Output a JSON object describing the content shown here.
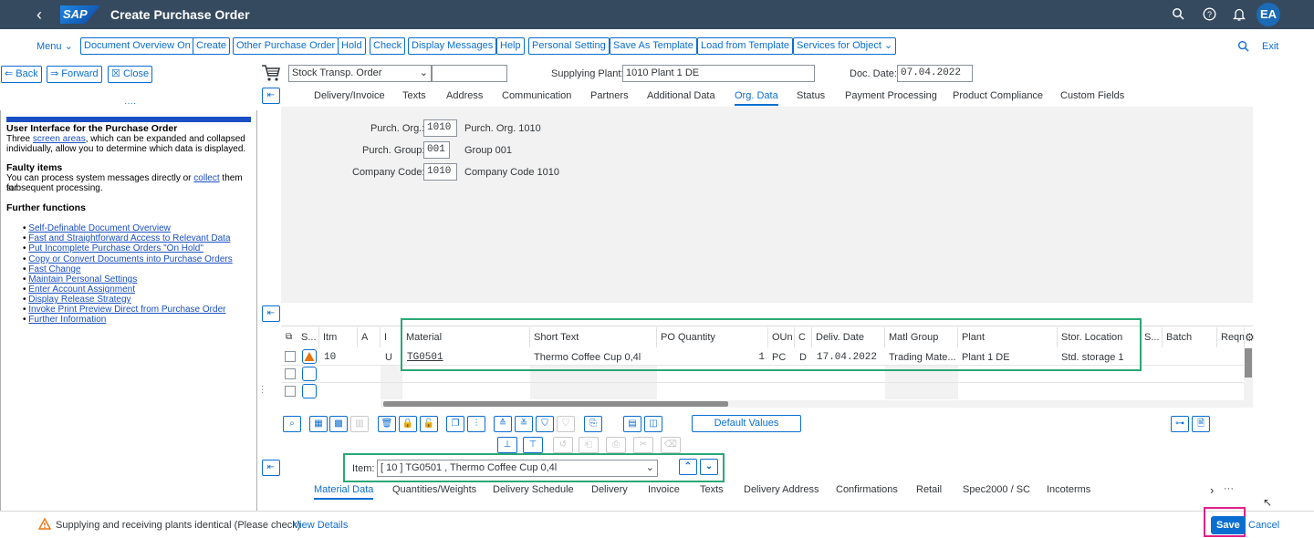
{
  "shell": {
    "title": "Create Purchase Order",
    "logo": "SAP",
    "avatar": "EA",
    "icons": [
      "back-icon",
      "search-icon",
      "help-icon",
      "bell-icon"
    ]
  },
  "toolbar": {
    "menu": "Menu",
    "buttons": [
      "Document Overview On",
      "Create",
      "Other Purchase Order",
      "Hold",
      "Check",
      "Display Messages",
      "Help",
      "Personal Setting",
      "Save As Template",
      "Load from Template",
      "Services for Object"
    ],
    "exit": "Exit"
  },
  "nav": {
    "back": "Back",
    "forward": "Forward",
    "close": "Close"
  },
  "left_pane": {
    "title": "User Interface for the Purchase Order",
    "l1a": "Three ",
    "l1link": "screen areas",
    "l1b": ", which can be expanded and collapsed",
    "l2": "individually, allow you to determine which data is displayed.",
    "faulty_title": "Faulty items",
    "f1a": "You can process system messages directly or ",
    "f1link": "collect",
    "f1b": " them for",
    "f2": "subsequent processing.",
    "further_title": "Further functions",
    "links": [
      "Self-Definable Document Overview",
      "Fast and Straightforward Access to Relevant Data",
      "Put Incomplete Purchase Orders \"On Hold\"",
      "Copy or Convert Documents into Purchase Orders",
      "Fast Change",
      "Maintain Personal Settings",
      "Enter Account Assignment",
      "Display Release Strategy",
      "Invoke Print Preview Direct from Purchase Order",
      "Further Information"
    ]
  },
  "header": {
    "order_type": "Stock Transp. Order",
    "doc_number": "",
    "supplying_plant_label": "Supplying Plant:",
    "supplying_plant_value": "1010 Plant 1 DE",
    "doc_date_label": "Doc. Date:",
    "doc_date_value": "07.04.2022",
    "tabs": [
      "Delivery/Invoice",
      "Texts",
      "Address",
      "Communication",
      "Partners",
      "Additional Data",
      "Org. Data",
      "Status",
      "Payment Processing",
      "Product Compliance",
      "Custom Fields"
    ],
    "active_tab": "Org. Data"
  },
  "org": {
    "purch_org_label": "Purch. Org.:",
    "purch_org_value": "1010",
    "purch_org_desc": "Purch. Org. 1010",
    "purch_group_label": "Purch. Group:",
    "purch_group_value": "001",
    "purch_group_desc": "Group 001",
    "company_code_label": "Company Code:",
    "company_code_value": "1010",
    "company_code_desc": "Company Code 1010"
  },
  "items": {
    "columns": [
      "S...",
      "Itm",
      "A",
      "I",
      "Material",
      "Short Text",
      "PO Quantity",
      "OUn",
      "C",
      "Deliv. Date",
      "Matl Group",
      "Plant",
      "Stor. Location",
      "S...",
      "Batch",
      "Reqm"
    ],
    "row": {
      "itm": "10",
      "i": "U",
      "material": "TG0501",
      "short_text": "Thermo Coffee Cup 0,4l",
      "po_quantity": "1",
      "oun": "PC",
      "c": "D",
      "deliv_date": "17.04.2022",
      "matl_group": "Trading Mate...",
      "plant": "Plant 1 DE",
      "stor_location": "Std. storage 1"
    },
    "default_values": "Default Values"
  },
  "item_detail": {
    "label": "Item:",
    "value": "[ 10 ] TG0501 , Thermo Coffee Cup 0,4l",
    "tabs": [
      "Material Data",
      "Quantities/Weights",
      "Delivery Schedule",
      "Delivery",
      "Invoice",
      "Texts",
      "Delivery Address",
      "Confirmations",
      "Retail",
      "Spec2000 / SC",
      "Incoterms"
    ],
    "active_tab": "Material Data"
  },
  "footer": {
    "message": "Supplying and receiving plants identical (Please check)",
    "view_details": "View Details",
    "save": "Save",
    "cancel": "Cancel"
  },
  "colors": {
    "shell": "#354a5f",
    "accent": "#0a6ed1",
    "highlight": "#2aa876",
    "save_highlight": "#e0218a",
    "warning": "#e9730c"
  }
}
